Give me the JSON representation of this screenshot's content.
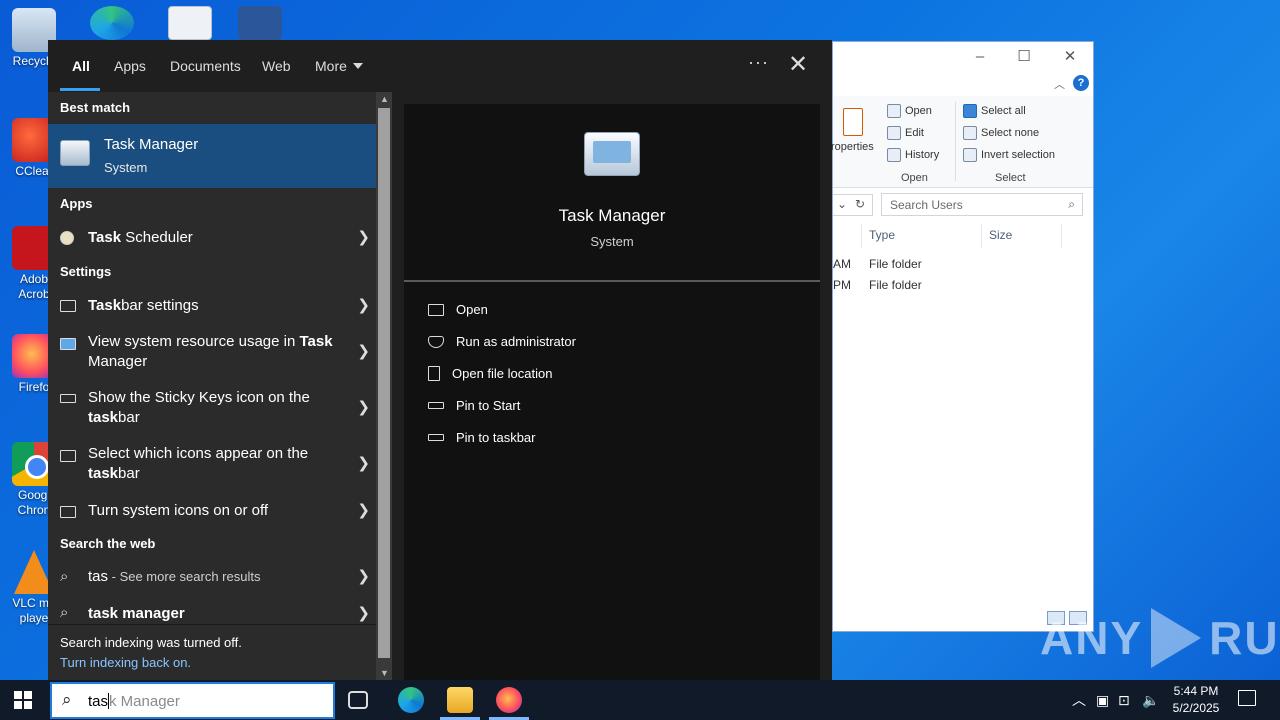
{
  "desktop": {
    "icons": [
      {
        "label": "Recycle",
        "icon": "recycle-bin-icon"
      },
      {
        "label": "CClear",
        "icon": "ccleaner-icon"
      },
      {
        "label": "Adob Acrob",
        "icon": "adobe-acrobat-icon"
      },
      {
        "label": "Firefo",
        "icon": "firefox-icon"
      },
      {
        "label": "Googl Chron",
        "icon": "chrome-icon"
      },
      {
        "label": "VLC me playe",
        "icon": "vlc-icon"
      }
    ]
  },
  "explorer": {
    "ribbon": {
      "properties": "roperties",
      "open": "Open",
      "edit": "Edit",
      "history": "History",
      "group_open": "Open",
      "select_all": "Select all",
      "select_none": "Select none",
      "invert_selection": "Invert selection",
      "group_select": "Select"
    },
    "search_placeholder": "Search Users",
    "columns": {
      "type": "Type",
      "size": "Size"
    },
    "rows": [
      {
        "date_tail": "AM",
        "type": "File folder"
      },
      {
        "date_tail": "PM",
        "type": "File folder"
      }
    ],
    "help": "?"
  },
  "watermark": {
    "left": "ANY",
    "right": "RUN"
  },
  "search": {
    "tabs": [
      "All",
      "Apps",
      "Documents",
      "Web",
      "More"
    ],
    "dots": "···",
    "close": "✕",
    "best_match_header": "Best match",
    "best_match": {
      "bold": "Task",
      "rest": " Manager",
      "subtitle": "System"
    },
    "apps_header": "Apps",
    "apps": [
      {
        "bold": "Task",
        "rest": " Scheduler"
      }
    ],
    "settings_header": "Settings",
    "settings": [
      {
        "line1_bold": "Task",
        "line1_rest": "bar settings",
        "line2_pre": "",
        "line2_bold": "",
        "line2_rest": ""
      },
      {
        "line1_pre": "View system resource usage in ",
        "line1_bold": "Task",
        "line2_rest": "Manager"
      },
      {
        "line1_pre": "Show the Sticky Keys icon on the",
        "line2_bold": "task",
        "line2_rest": "bar"
      },
      {
        "line1_pre": "Select which icons appear on the",
        "line2_bold": "task",
        "line2_rest": "bar"
      },
      {
        "line1_pre": "Turn system icons on or off"
      }
    ],
    "web_header": "Search the web",
    "web": [
      {
        "text": "tas",
        "dim": " - See more search results"
      },
      {
        "bold": "task manager"
      }
    ],
    "footer": {
      "line1": "Search indexing was turned off.",
      "line2": "Turn indexing back on."
    },
    "detail": {
      "title": "Task Manager",
      "subtitle": "System",
      "actions": [
        "Open",
        "Run as administrator",
        "Open file location",
        "Pin to Start",
        "Pin to taskbar"
      ]
    }
  },
  "taskbar": {
    "search_typed": "tas",
    "search_ghost": "k Manager",
    "time": "5:44 PM",
    "date": "5/2/2025"
  }
}
